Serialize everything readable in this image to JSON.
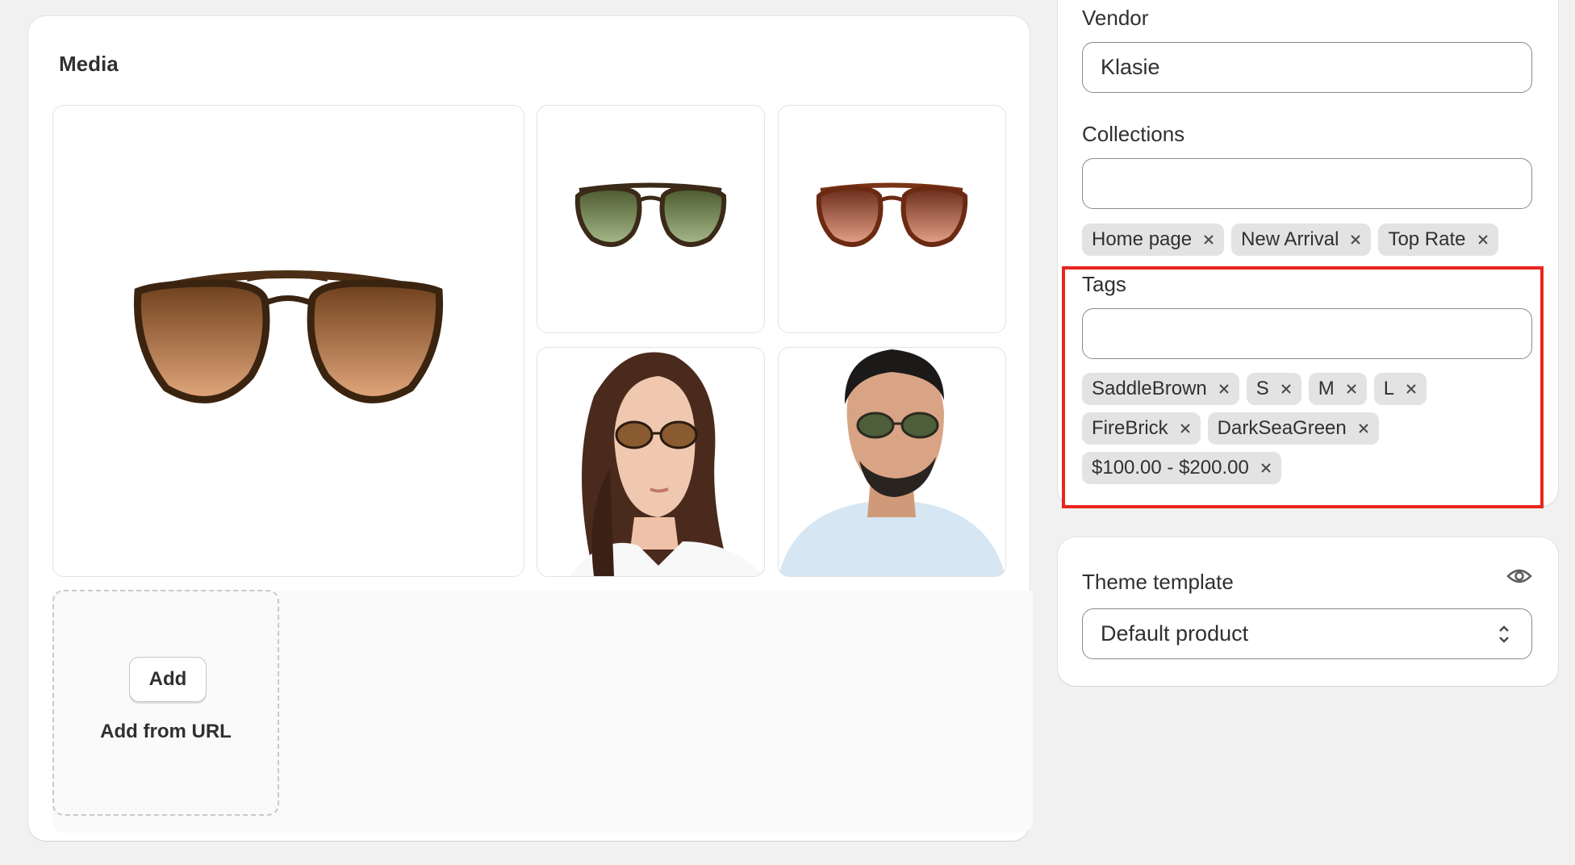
{
  "media": {
    "title": "Media",
    "images": [
      {
        "name": "sunglasses-brown-front",
        "lens_color": "#b8743f"
      },
      {
        "name": "sunglasses-green",
        "lens_color": "#6f8a5a"
      },
      {
        "name": "sunglasses-red",
        "lens_color": "#b45f47"
      },
      {
        "name": "model-woman",
        "lens_color": "#8a5a30"
      },
      {
        "name": "model-man",
        "lens_color": "#4f5e3a"
      }
    ],
    "add_button": "Add",
    "add_from_url": "Add from URL"
  },
  "organization": {
    "vendor_label": "Vendor",
    "vendor_value": "Klasie",
    "collections_label": "Collections",
    "collections_value": "",
    "collections": [
      "Home page",
      "New Arrival",
      "Top Rate"
    ],
    "tags_label": "Tags",
    "tags_value": "",
    "tags": [
      [
        "SaddleBrown",
        "S",
        "M",
        "L"
      ],
      [
        "FireBrick",
        "DarkSeaGreen"
      ],
      [
        "$100.00 - $200.00"
      ]
    ]
  },
  "theme": {
    "label": "Theme template",
    "value": "Default product"
  },
  "colors": {
    "highlight": "#e8261b",
    "chip_bg": "#e3e3e3"
  }
}
